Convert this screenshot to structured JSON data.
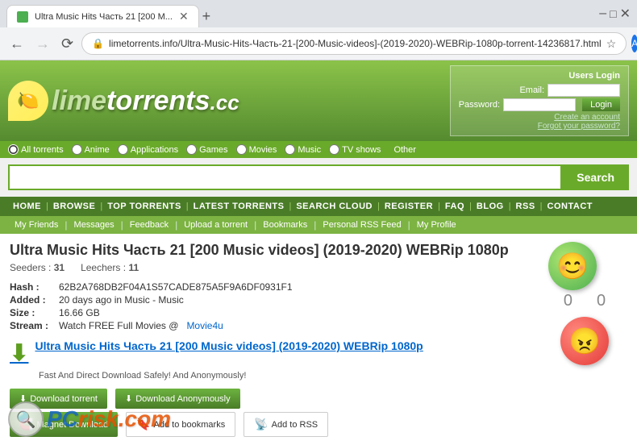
{
  "browser": {
    "tab_title": "Ultra Music Hits Часть 21 [200 M...",
    "address": "limetorrents.info/Ultra-Music-Hits-Часть-21-[200-Music-videos]-(2019-2020)-WEBRip-1080p-torrent-14236817.html",
    "nav_back_disabled": false,
    "nav_forward_disabled": true
  },
  "header": {
    "logo": "limetorrents.cc",
    "logo_lime": "lime",
    "logo_rest": "torrents",
    "logo_suffix": ".cc",
    "login_title": "Users Login",
    "email_label": "Email:",
    "password_label": "Password:",
    "login_btn": "Login",
    "create_account": "Create an account",
    "forgot_password": "Forgot your password?"
  },
  "categories": {
    "items": [
      {
        "label": "All torrents",
        "checked": true
      },
      {
        "label": "Anime",
        "checked": false
      },
      {
        "label": "Applications",
        "checked": false
      },
      {
        "label": "Games",
        "checked": false
      },
      {
        "label": "Movies",
        "checked": false
      },
      {
        "label": "Music",
        "checked": false
      },
      {
        "label": "TV shows",
        "checked": false
      }
    ],
    "other_label": "Other"
  },
  "search": {
    "placeholder": "",
    "button_label": "Search"
  },
  "main_nav": {
    "items": [
      "HOME",
      "BROWSE",
      "TOP TORRENTS",
      "LATEST TORRENTS",
      "SEARCH CLOUD",
      "REGISTER",
      "FAQ",
      "BLOG",
      "RSS",
      "CONTACT"
    ]
  },
  "sub_nav": {
    "items": [
      "My Friends",
      "Messages",
      "Feedback",
      "Upload a torrent",
      "Bookmarks",
      "Personal RSS Feed",
      "My Profile"
    ]
  },
  "torrent": {
    "title": "Ultra Music Hits Часть 21 [200 Music videos] (2019-2020) WEBRip 1080p",
    "seeders": "31",
    "leechers": "11",
    "hash": "62B2A768DB2F04A1S57CADE875A5F9A6DF0931F1",
    "added": "20 days ago in Music - Music",
    "size": "16.66 GB",
    "stream_text": "Watch FREE Full Movies @",
    "stream_link": "Movie4u",
    "download_title": "Ultra Music Hits Часть 21 [200 Music videos] (2019-2020) WEBRip 1080p",
    "safe_text": "Fast And Direct Download Safely! And Anonymously!",
    "btn_download_torrent": "Download torrent",
    "btn_download_anon": "Download Anonymously",
    "btn_magnet": "Magnet Download",
    "btn_bookmarks": "Add to bookmarks",
    "btn_rss": "Add to RSS"
  },
  "watermark": {
    "text_colored": "PC",
    "text_rest": "risk.com"
  }
}
